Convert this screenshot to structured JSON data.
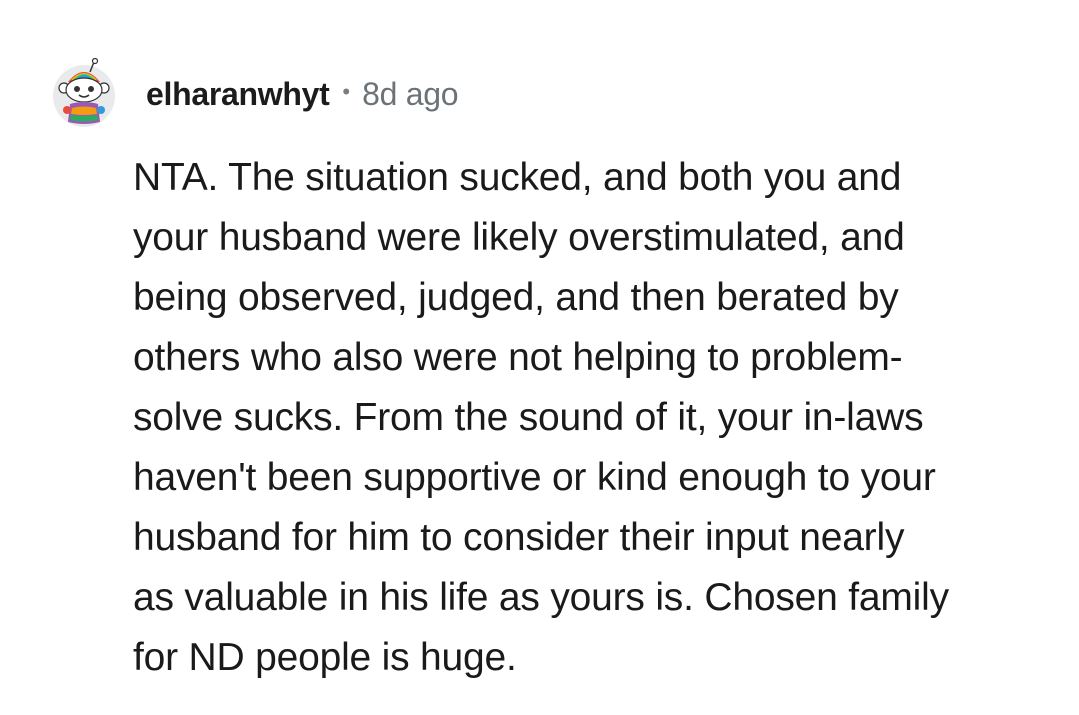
{
  "comment": {
    "username": "elharanwhyt",
    "separator": "•",
    "timestamp": "8d ago",
    "body_lines": [
      "NTA. The situation sucked, and both you and",
      "your husband were likely overstimulated, and",
      "being observed, judged, and then berated by",
      "others who also were not helping to problem-",
      "solve sucks. From the sound of it, your in-laws",
      "haven't been supportive or kind enough to your",
      "husband for him to consider their input nearly",
      "as valuable in his life as yours is. Chosen family",
      "for ND people is huge."
    ]
  },
  "colors": {
    "background": "#ffffff",
    "text": "#1a1a1b",
    "meta": "#6b7378"
  },
  "icons": {
    "avatar": "snoo-avatar-icon"
  }
}
